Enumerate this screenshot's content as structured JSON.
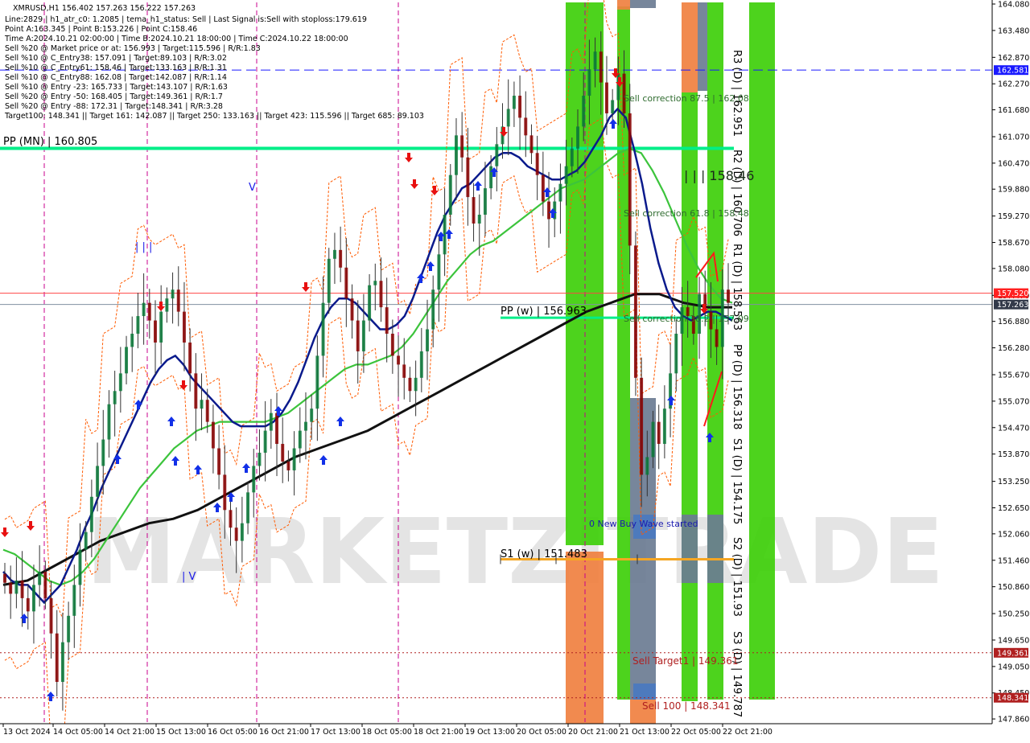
{
  "header": {
    "symbol_line": "XMRUSD,H1  156.402 157.263 156.222 157.263",
    "info_lines": [
      "Line:2829 | h1_atr_c0: 1.2085 | tema_h1_status: Sell | Last Signal is:Sell with stoploss:179.619",
      "Point A:163.345 | Point B:153.226 | Point C:158.46",
      "Time A:2024.10.21 02:00:00 | Time B:2024.10.21 18:00:00 | Time C:2024.10.22 18:00:00",
      "Sell %20 @ Market price or at: 156.993 | Target:115.596 | R/R:1.83",
      "Sell %10 @ C_Entry38: 157.091 | Target:89.103 | R/R:3.02",
      "Sell %10 @ C_Entry61: 158.46 | Target:133.163 | R/R:1.31",
      "Sell %10 @ C_Entry88: 162.08 | Target:142.087 | R/R:1.14",
      "Sell %10 @ Entry -23: 165.733 | Target:143.107 | R/R:1.63",
      "Sell %20 @ Entry -50: 168.405 | Target:149.361 | R/R:1.7",
      "Sell %20 @ Entry -88: 172.31 | Target:148.341 | R/R:3.28",
      "Target100: 148.341 || Target 161: 142.087 || Target 250: 133.163 || Target 423: 115.596 || Target 685: 89.103"
    ]
  },
  "watermark": "MARKETZITRADE",
  "colors": {
    "bull": "#0a7a3a",
    "bear": "#8b0000",
    "wick": "#333333",
    "zone_green": "#3ecf0a",
    "zone_orange": "#f08040",
    "zone_slate": "#6b7c93",
    "ema_blue": "#0a1a8c",
    "ema_green": "#3cc43c",
    "ma_black": "#111111",
    "envelope": "#ff5a00",
    "pivot_monthly": "#00ee88",
    "pivot_weekly_pp": "#00ee88",
    "pivot_weekly_s1": "#f5a623",
    "r3_dashed": "#1a1aff",
    "current_price_line": "#ff4444",
    "session_divider": "#c8008c",
    "buy_arrow": "#1230e8",
    "sell_arrow": "#e81010"
  },
  "chart_data": {
    "type": "candlestick",
    "symbol": "XMRUSD",
    "timeframe": "H1",
    "ylim": [
      147.825,
      164.08
    ],
    "y_ticks": [
      164.08,
      163.48,
      162.87,
      162.27,
      161.68,
      161.07,
      160.47,
      159.88,
      159.27,
      158.67,
      158.08,
      157.47,
      156.88,
      156.28,
      155.67,
      155.07,
      154.47,
      153.87,
      153.25,
      152.65,
      152.06,
      151.46,
      150.86,
      150.25,
      149.65,
      149.05,
      148.45,
      147.86
    ],
    "x_labels": [
      "13 Oct 2024",
      "14 Oct 05:00",
      "14 Oct 21:00",
      "15 Oct 13:00",
      "16 Oct 05:00",
      "16 Oct 21:00",
      "17 Oct 13:00",
      "18 Oct 05:00",
      "18 Oct 21:00",
      "19 Oct 13:00",
      "20 Oct 05:00",
      "20 Oct 21:00",
      "21 Oct 13:00",
      "22 Oct 05:00",
      "22 Oct 21:00"
    ],
    "price_tags": [
      {
        "value": 162.581,
        "label": "162.581",
        "color": "#1a1aff"
      },
      {
        "value": 157.52,
        "label": "157.520",
        "color": "#ff2020"
      },
      {
        "value": 157.263,
        "label": "157.263",
        "color": "#333a4a"
      },
      {
        "value": 149.361,
        "label": "149.361",
        "color": "#b02020"
      },
      {
        "value": 148.341,
        "label": "148.341",
        "color": "#b02020"
      }
    ],
    "horizontal_levels": [
      {
        "name": "monthly-pivot",
        "value": 160.805,
        "label": "PP (MN) | 160.805",
        "style": "solid",
        "color": "#00ee88"
      },
      {
        "name": "weekly-pivot",
        "value": 156.963,
        "label": "PP (w) | 156.963",
        "style": "solid",
        "color": "#00ee88"
      },
      {
        "name": "weekly-s1",
        "value": 151.483,
        "label": "S1 (w) | 151.483",
        "style": "solid",
        "color": "#f5a623"
      },
      {
        "name": "r3-dashed",
        "value": 162.581,
        "label": "",
        "style": "dashed",
        "color": "#1a1aff"
      },
      {
        "name": "current-price-red",
        "value": 157.52,
        "label": "",
        "style": "thin",
        "color": "#ff4444"
      },
      {
        "name": "current-price-grey",
        "value": 157.263,
        "label": "",
        "style": "thin",
        "color": "#8090a0"
      },
      {
        "name": "sell-target-dotted",
        "value": 149.361,
        "label": "",
        "style": "dotted",
        "color": "#b02020"
      },
      {
        "name": "sell-100-dotted",
        "value": 148.341,
        "label": "",
        "style": "dotted",
        "color": "#b02020"
      }
    ],
    "daily_pivots": [
      {
        "label": "R3 (D) | 162.951"
      },
      {
        "label": "R2 (D) | 160.706"
      },
      {
        "label": "R1 (D) | 158.563"
      },
      {
        "label": "PP (D) | 156.318"
      },
      {
        "label": "S1 (D) | 154.175"
      },
      {
        "label": "S2 (D) | 151.93"
      },
      {
        "label": "S3 (D) | 149.787"
      }
    ],
    "annotations": [
      "Sell correction 87.5 | 162.08",
      "Sell correction 61.8 | 158.48",
      "Sell correction 38.2 | 157.09",
      "| | | 158.46",
      "0 New Buy Wave started",
      "Sell Target1 | 149.361",
      "Sell 100 | 148.341"
    ],
    "wave_marks": [
      "| | |",
      "V",
      "| V"
    ],
    "close_series": [
      150.95,
      150.7,
      151.0,
      150.6,
      150.3,
      150.9,
      151.2,
      150.6,
      149.8,
      148.7,
      149.6,
      150.2,
      150.9,
      151.7,
      152.1,
      152.9,
      153.6,
      154.2,
      155.0,
      155.3,
      155.7,
      156.3,
      156.6,
      157.0,
      157.3,
      156.9,
      156.4,
      157.1,
      157.4,
      157.6,
      157.1,
      156.4,
      155.7,
      154.9,
      155.1,
      154.6,
      154.0,
      153.4,
      152.6,
      152.2,
      151.9,
      152.3,
      153.0,
      153.6,
      153.9,
      154.4,
      154.8,
      154.1,
      153.7,
      153.5,
      154.0,
      154.4,
      154.6,
      154.9,
      156.1,
      157.3,
      158.3,
      158.5,
      158.1,
      157.4,
      156.9,
      156.2,
      156.9,
      157.7,
      157.8,
      157.2,
      156.6,
      156.1,
      155.9,
      155.6,
      155.3,
      155.6,
      156.2,
      156.7,
      157.6,
      158.4,
      159.3,
      160.2,
      161.1,
      160.6,
      159.7,
      159.1,
      159.3,
      159.9,
      160.4,
      160.9,
      161.3,
      161.7,
      162.0,
      161.5,
      161.1,
      160.7,
      160.2,
      159.6,
      159.2,
      159.6,
      160.0,
      160.4,
      160.8,
      161.3,
      162.0,
      162.6,
      163.0,
      162.3,
      161.6,
      161.9,
      162.5,
      161.6,
      158.6,
      155.6,
      153.4,
      153.8,
      154.6,
      154.1,
      154.9,
      155.7,
      156.6,
      157.2,
      157.0,
      156.6,
      157.5,
      157.1,
      156.7,
      156.3,
      157.6,
      157.3
    ],
    "blue_ema_series": [
      151.2,
      151.0,
      150.9,
      150.9,
      150.7,
      150.5,
      150.7,
      150.9,
      151.3,
      151.7,
      152.2,
      152.6,
      153.1,
      153.5,
      153.9,
      154.3,
      154.7,
      155.1,
      155.5,
      155.8,
      156.0,
      156.1,
      155.9,
      155.6,
      155.4,
      155.2,
      155.0,
      154.8,
      154.6,
      154.5,
      154.5,
      154.5,
      154.5,
      154.6,
      154.8,
      155.1,
      155.5,
      156.0,
      156.5,
      156.9,
      157.2,
      157.4,
      157.4,
      157.3,
      157.1,
      156.9,
      156.7,
      156.7,
      156.8,
      157.0,
      157.4,
      157.9,
      158.4,
      158.9,
      159.3,
      159.6,
      159.9,
      160.0,
      160.2,
      160.4,
      160.6,
      160.7,
      160.7,
      160.6,
      160.4,
      160.3,
      160.2,
      160.1,
      160.1,
      160.2,
      160.3,
      160.5,
      160.8,
      161.1,
      161.5,
      161.7,
      161.5,
      160.8,
      160.0,
      159.0,
      158.2,
      157.6,
      157.2,
      157.0,
      156.9,
      157.0,
      157.1,
      157.1,
      157.0,
      156.9
    ],
    "green_ema_series": [
      151.7,
      151.6,
      151.4,
      151.2,
      151.0,
      150.9,
      151.0,
      151.2,
      151.5,
      151.9,
      152.3,
      152.7,
      153.1,
      153.4,
      153.7,
      154.0,
      154.2,
      154.4,
      154.5,
      154.6,
      154.6,
      154.6,
      154.6,
      154.6,
      154.7,
      154.8,
      155.0,
      155.2,
      155.4,
      155.6,
      155.8,
      155.9,
      155.9,
      156.0,
      156.1,
      156.3,
      156.6,
      157.0,
      157.4,
      157.8,
      158.1,
      158.4,
      158.6,
      158.7,
      158.9,
      159.1,
      159.3,
      159.5,
      159.7,
      159.9,
      160.0,
      160.1,
      160.3,
      160.5,
      160.7,
      160.8,
      160.7,
      160.3,
      159.8,
      159.2,
      158.6,
      158.1,
      157.7,
      157.4,
      157.3
    ],
    "black_ma_series": [
      150.9,
      151.0,
      151.3,
      151.6,
      151.9,
      152.1,
      152.3,
      152.4,
      152.6,
      152.9,
      153.2,
      153.5,
      153.8,
      154.0,
      154.2,
      154.4,
      154.7,
      155.0,
      155.3,
      155.6,
      155.9,
      156.2,
      156.5,
      156.8,
      157.1,
      157.3,
      157.5,
      157.5,
      157.3,
      157.2,
      157.2
    ]
  }
}
